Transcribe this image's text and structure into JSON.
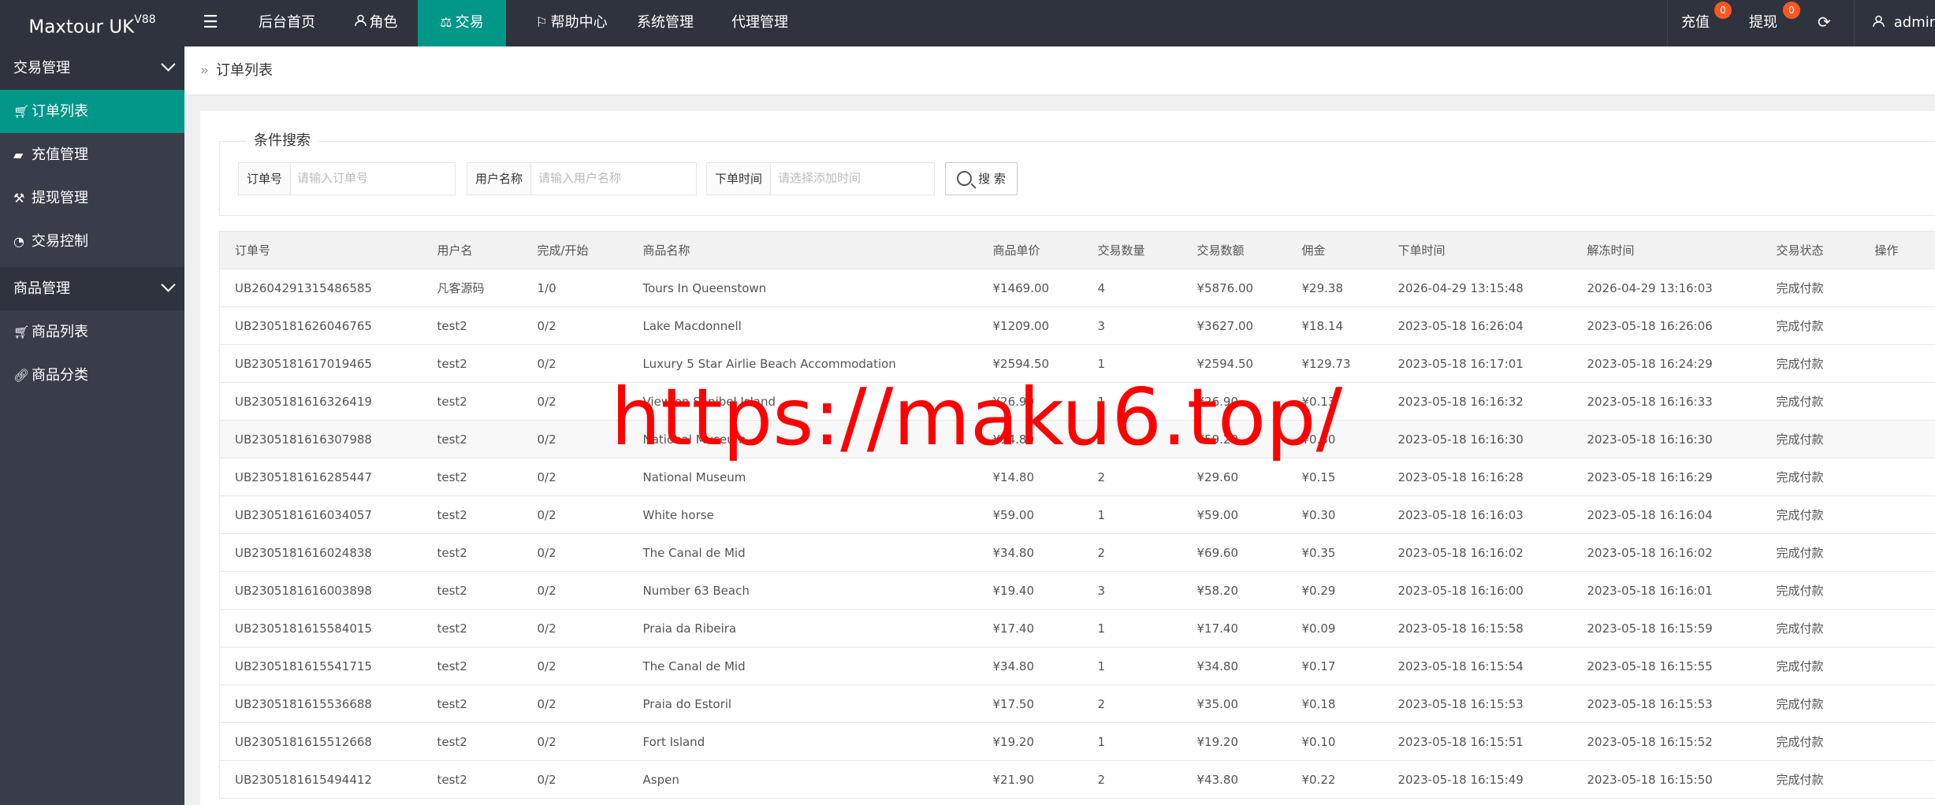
{
  "app": {
    "brand": "Maxtour UK",
    "brand_version": "V88"
  },
  "topnav": {
    "items": [
      {
        "label": "后台首页",
        "icon": ""
      },
      {
        "label": "角色",
        "icon": "user-icon"
      },
      {
        "label": "交易",
        "icon": "scale-icon",
        "active": true
      },
      {
        "label": "帮助中心",
        "icon": "flag-icon"
      },
      {
        "label": "系统管理",
        "icon": ""
      },
      {
        "label": "代理管理",
        "icon": ""
      }
    ],
    "recharge": {
      "label": "充值",
      "badge": "0"
    },
    "withdraw": {
      "label": "提现",
      "badge": "0"
    },
    "user": "admin"
  },
  "sidebar": {
    "groups": [
      {
        "label": "交易管理"
      },
      {
        "label": "商品管理"
      }
    ],
    "items": [
      {
        "label": "订单列表",
        "icon": "cart-icon",
        "active": true
      },
      {
        "label": "充值管理",
        "icon": "chat-icon"
      },
      {
        "label": "提现管理",
        "icon": "hammer-icon"
      },
      {
        "label": "交易控制",
        "icon": "gauge-icon"
      },
      {
        "label": "商品列表",
        "icon": "cart-icon"
      },
      {
        "label": "商品分类",
        "icon": "link-icon"
      }
    ]
  },
  "breadcrumb": {
    "current": "订单列表"
  },
  "search": {
    "legend": "条件搜索",
    "order_no_label": "订单号",
    "order_no_placeholder": "请输入订单号",
    "username_label": "用户名称",
    "username_placeholder": "请输入用户名称",
    "time_label": "下单时间",
    "time_placeholder": "请选择添加时间",
    "button": "搜 索"
  },
  "table": {
    "headers": [
      "订单号",
      "用户名",
      "完成/开始",
      "商品名称",
      "商品单价",
      "交易数量",
      "交易数额",
      "佣金",
      "下单时间",
      "解冻时间",
      "交易状态",
      "操作"
    ],
    "rows": [
      [
        "UB2604291315486585",
        "凡客源码",
        "1/0",
        "Tours In Queenstown",
        "¥1469.00",
        "4",
        "¥5876.00",
        "¥29.38",
        "2026-04-29 13:15:48",
        "2026-04-29 13:16:03",
        "完成付款",
        ""
      ],
      [
        "UB2305181626046765",
        "test2",
        "0/2",
        "Lake Macdonnell",
        "¥1209.00",
        "3",
        "¥3627.00",
        "¥18.14",
        "2023-05-18 16:26:04",
        "2023-05-18 16:26:06",
        "完成付款",
        ""
      ],
      [
        "UB2305181617019465",
        "test2",
        "0/2",
        "Luxury 5 Star Airlie Beach Accommodation",
        "¥2594.50",
        "1",
        "¥2594.50",
        "¥129.73",
        "2023-05-18 16:17:01",
        "2023-05-18 16:24:29",
        "完成付款",
        ""
      ],
      [
        "UB2305181616326419",
        "test2",
        "0/2",
        "View on Sanibel Island",
        "¥26.90",
        "1",
        "¥26.90",
        "¥0.13",
        "2023-05-18 16:16:32",
        "2023-05-18 16:16:33",
        "完成付款",
        ""
      ],
      [
        "UB2305181616307988",
        "test2",
        "0/2",
        "National Museum",
        "¥14.80",
        "4",
        "¥59.20",
        "¥0.30",
        "2023-05-18 16:16:30",
        "2023-05-18 16:16:30",
        "完成付款",
        ""
      ],
      [
        "UB2305181616285447",
        "test2",
        "0/2",
        "National Museum",
        "¥14.80",
        "2",
        "¥29.60",
        "¥0.15",
        "2023-05-18 16:16:28",
        "2023-05-18 16:16:29",
        "完成付款",
        ""
      ],
      [
        "UB2305181616034057",
        "test2",
        "0/2",
        "White horse",
        "¥59.00",
        "1",
        "¥59.00",
        "¥0.30",
        "2023-05-18 16:16:03",
        "2023-05-18 16:16:04",
        "完成付款",
        ""
      ],
      [
        "UB2305181616024838",
        "test2",
        "0/2",
        "The Canal de Mid",
        "¥34.80",
        "2",
        "¥69.60",
        "¥0.35",
        "2023-05-18 16:16:02",
        "2023-05-18 16:16:02",
        "完成付款",
        ""
      ],
      [
        "UB2305181616003898",
        "test2",
        "0/2",
        "Number 63 Beach",
        "¥19.40",
        "3",
        "¥58.20",
        "¥0.29",
        "2023-05-18 16:16:00",
        "2023-05-18 16:16:01",
        "完成付款",
        ""
      ],
      [
        "UB2305181615584015",
        "test2",
        "0/2",
        "Praia da Ribeira",
        "¥17.40",
        "1",
        "¥17.40",
        "¥0.09",
        "2023-05-18 16:15:58",
        "2023-05-18 16:15:59",
        "完成付款",
        ""
      ],
      [
        "UB2305181615541715",
        "test2",
        "0/2",
        "The Canal de Mid",
        "¥34.80",
        "1",
        "¥34.80",
        "¥0.17",
        "2023-05-18 16:15:54",
        "2023-05-18 16:15:55",
        "完成付款",
        ""
      ],
      [
        "UB2305181615536688",
        "test2",
        "0/2",
        "Praia do Estoril",
        "¥17.50",
        "2",
        "¥35.00",
        "¥0.18",
        "2023-05-18 16:15:53",
        "2023-05-18 16:15:53",
        "完成付款",
        ""
      ],
      [
        "UB2305181615512668",
        "test2",
        "0/2",
        "Fort Island",
        "¥19.20",
        "1",
        "¥19.20",
        "¥0.10",
        "2023-05-18 16:15:51",
        "2023-05-18 16:15:52",
        "完成付款",
        ""
      ],
      [
        "UB2305181615494412",
        "test2",
        "0/2",
        "Aspen",
        "¥21.90",
        "2",
        "¥43.80",
        "¥0.22",
        "2023-05-18 16:15:49",
        "2023-05-18 16:15:50",
        "完成付款",
        ""
      ]
    ]
  },
  "watermark": "https://maku6.top/",
  "colors": {
    "topbar": "#2f333e",
    "sidebar": "#393d49",
    "accent": "#009688",
    "badge": "#ff5722",
    "watermark": "#ff0000"
  }
}
